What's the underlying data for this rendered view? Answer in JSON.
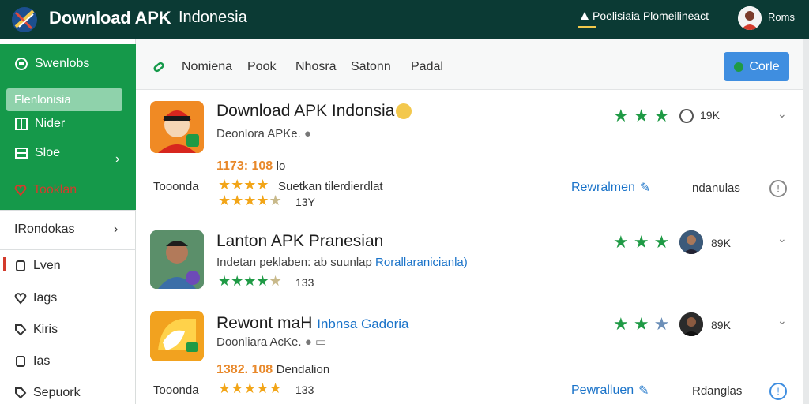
{
  "header": {
    "title": "Download APK",
    "subtitle": "Indonesia",
    "promo_text": "Poolisiaia Plomeilineact",
    "user_name": "Roms"
  },
  "sidebar": {
    "items": [
      {
        "label": "Swenlobs",
        "icon": "gamepad-icon"
      },
      {
        "label": "Flenlonisia",
        "icon": "selected-item"
      },
      {
        "label": "Nider",
        "icon": "grid-icon"
      },
      {
        "label": "Sloe",
        "icon": "store-icon"
      },
      {
        "label": "Tooklan",
        "icon": "heart-icon"
      },
      {
        "label": "IRondokas",
        "icon": "none"
      },
      {
        "label": "Lven",
        "icon": "square-icon"
      },
      {
        "label": "Iags",
        "icon": "heart-icon"
      },
      {
        "label": "Kiris",
        "icon": "tag-icon"
      },
      {
        "label": "Ias",
        "icon": "square-icon"
      },
      {
        "label": "Sepuork",
        "icon": "tag-icon"
      }
    ]
  },
  "tabs": {
    "items": [
      "Nomiena",
      "Pook",
      "Nhosra",
      "Satonn",
      "Padal"
    ],
    "cta_label": "Corle"
  },
  "apps": [
    {
      "name": "Download APK Indonsia",
      "developer": "Deonlora APKe.",
      "price": "1173: 108",
      "price_suffix": "lo",
      "category": "Tooonda",
      "rating_text": "Suetkan tilerdierdlat",
      "review_count": "13Y",
      "metric": "19K",
      "action_label": "Rewralmen",
      "action2_label": "ndanulas",
      "green_stars": 3
    },
    {
      "name": "Lanton APK Pranesian",
      "description": "Indetan peklaben: ab suunlap",
      "description_link": "Rorallaranicianla)",
      "review_count": "133",
      "metric": "89K",
      "green_stars": 3
    },
    {
      "name": "Rewont maH",
      "name_link": "Inbnsa Gadoria",
      "developer": "Doonliara AcKe.",
      "price": "1382. 108",
      "price_suffix": "Dendalion",
      "category": "Tooonda",
      "review_count": "133",
      "metric": "89K",
      "action_label": "Pewralluen",
      "action2_label": "Rdanglas",
      "green_stars": 3
    }
  ]
}
